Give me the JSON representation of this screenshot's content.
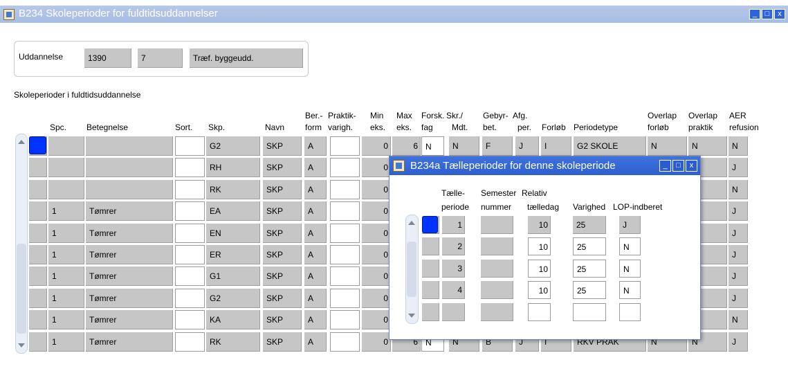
{
  "window": {
    "title": "B234 Skoleperioder for fuldtidsuddannelser",
    "icon": "app-icon",
    "buttons": {
      "minimize": "_",
      "maximize": "□",
      "close": "x"
    }
  },
  "header_block": {
    "label": "Uddannelse",
    "code": "1390",
    "number": "7",
    "name": "Træf. byggeudd."
  },
  "section_title": "Skoleperioder i fuldtidsuddannelse",
  "columns": {
    "spc": "Spc.",
    "betegnelse": "Betegnelse",
    "sort": "Sort.",
    "skp": "Skp.",
    "navn": "Navn",
    "ber_l1": "Ber.-",
    "ber_l2": "form",
    "prak_l1": "Praktik-",
    "prak_l2": "varigh.",
    "min_l1": "Min",
    "min_l2": "eks.",
    "max_l1": "Max",
    "max_l2": "eks.",
    "forsk_l1": "Forsk.",
    "forsk_l2": "fag",
    "skr_l1": "Skr./",
    "skr_l2": "Mdt.",
    "geb_l1": "Gebyr-",
    "geb_l2": "bet.",
    "afg_l1": "Afg.",
    "afg_l2": "per.",
    "forloeb": "Forløb",
    "periodetype": "Periodetype",
    "ovf_l1": "Overlap",
    "ovf_l2": "forløb",
    "ovp_l1": "Overlap",
    "ovp_l2": "praktik",
    "aer_l1": "AER",
    "aer_l2": "refusion"
  },
  "rows": [
    {
      "spc": "",
      "betegnelse": "",
      "skp": "G2",
      "navn": "SKP",
      "ber": "A",
      "min": "0",
      "max": "6",
      "forsk": "N",
      "skr": "N",
      "geb": "F",
      "afg": "J",
      "forloeb": "I",
      "periodetype": "G2 SKOLE",
      "ovf": "N",
      "ovp": "N",
      "aer": "N"
    },
    {
      "spc": "",
      "betegnelse": "",
      "skp": "RH",
      "navn": "SKP",
      "ber": "A",
      "min": "0",
      "aer": "J"
    },
    {
      "spc": "",
      "betegnelse": "",
      "skp": "RK",
      "navn": "SKP",
      "ber": "A",
      "min": "0",
      "aer": "N"
    },
    {
      "spc": "1",
      "betegnelse": "Tømrer",
      "skp": "EA",
      "navn": "SKP",
      "ber": "A",
      "min": "0",
      "aer": "J"
    },
    {
      "spc": "1",
      "betegnelse": "Tømrer",
      "skp": "EN",
      "navn": "SKP",
      "ber": "A",
      "min": "0",
      "aer": "J"
    },
    {
      "spc": "1",
      "betegnelse": "Tømrer",
      "skp": "ER",
      "navn": "SKP",
      "ber": "A",
      "min": "0",
      "aer": "J"
    },
    {
      "spc": "1",
      "betegnelse": "Tømrer",
      "skp": "G1",
      "navn": "SKP",
      "ber": "A",
      "min": "0",
      "aer": "J"
    },
    {
      "spc": "1",
      "betegnelse": "Tømrer",
      "skp": "G2",
      "navn": "SKP",
      "ber": "A",
      "min": "0",
      "aer": "J"
    },
    {
      "spc": "1",
      "betegnelse": "Tømrer",
      "skp": "KA",
      "navn": "SKP",
      "ber": "A",
      "min": "0",
      "aer": "N"
    },
    {
      "spc": "1",
      "betegnelse": "Tømrer",
      "skp": "RK",
      "navn": "SKP",
      "ber": "A",
      "min": "0",
      "max": "6",
      "forsk": "N",
      "skr": "N",
      "geb": "B",
      "afg": "J",
      "forloeb": "I",
      "periodetype": "RKV PRAK",
      "ovf": "N",
      "ovp": "N",
      "aer": "J"
    }
  ],
  "dialog": {
    "title": "B234a Tælleperioder for denne skoleperiode",
    "buttons": {
      "minimize": "_",
      "maximize": "□",
      "close": "x"
    },
    "columns": {
      "tp_l1": "Tælle-",
      "tp_l2": "periode",
      "sem_l1": "Semester",
      "sem_l2": "nummer",
      "rel_l1": "Relativ",
      "rel_l2": "tælledag",
      "varighed": "Varighed",
      "lop": "LOP-indberet"
    },
    "rows": [
      {
        "periode": "1",
        "semester": "",
        "tælledag": "10",
        "varighed": "25",
        "lop": "J"
      },
      {
        "periode": "2",
        "semester": "",
        "tælledag": "10",
        "varighed": "25",
        "lop": "N"
      },
      {
        "periode": "3",
        "semester": "",
        "tælledag": "10",
        "varighed": "25",
        "lop": "N"
      },
      {
        "periode": "4",
        "semester": "",
        "tælledag": "10",
        "varighed": "25",
        "lop": "N"
      },
      {
        "periode": "",
        "semester": "",
        "tælledag": "",
        "varighed": "",
        "lop": ""
      }
    ]
  },
  "colors": {
    "selection": "#0033ff",
    "field_gray": "#c6c6c6",
    "titlebar_inactive": "#a6bde6",
    "titlebar_active": "#2d5fcf"
  }
}
